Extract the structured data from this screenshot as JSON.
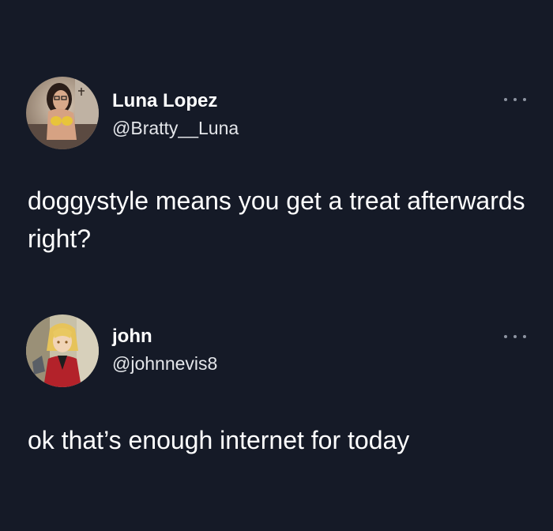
{
  "tweets": [
    {
      "display_name": "Luna Lopez",
      "handle": "@Bratty__Luna",
      "text": "doggystyle means you get a treat afterwards right?",
      "avatar_icon": "user-avatar-photo",
      "more_icon": "more-options-icon"
    },
    {
      "display_name": "john",
      "handle": "@johnnevis8",
      "text": "ok that’s enough internet for today",
      "avatar_icon": "anime-character-avatar",
      "more_icon": "more-options-icon"
    }
  ],
  "colors": {
    "background": "#151a27",
    "text_primary": "#ffffff",
    "text_secondary": "#e4e6ea",
    "icon_muted": "#8d94a1"
  }
}
